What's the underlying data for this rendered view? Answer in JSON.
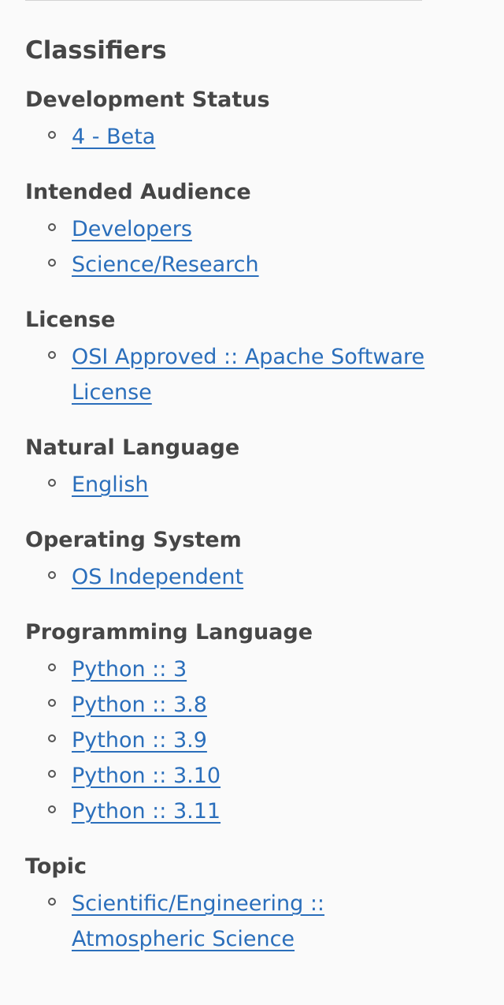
{
  "section": {
    "title": "Classifiers"
  },
  "groups": [
    {
      "title": "Development Status",
      "items": [
        "4 - Beta"
      ]
    },
    {
      "title": "Intended Audience",
      "items": [
        "Developers",
        "Science/Research"
      ]
    },
    {
      "title": "License",
      "items": [
        "OSI Approved :: Apache Software License"
      ]
    },
    {
      "title": "Natural Language",
      "items": [
        "English"
      ]
    },
    {
      "title": "Operating System",
      "items": [
        "OS Independent"
      ]
    },
    {
      "title": "Programming Language",
      "items": [
        "Python :: 3",
        "Python :: 3.8",
        "Python :: 3.9",
        "Python :: 3.10",
        "Python :: 3.11"
      ]
    },
    {
      "title": "Topic",
      "items": [
        "Scientific/Engineering :: Atmospheric Science"
      ]
    }
  ],
  "colors": {
    "link": "#2a6ebb",
    "text": "#464646",
    "background": "#fafafa"
  }
}
